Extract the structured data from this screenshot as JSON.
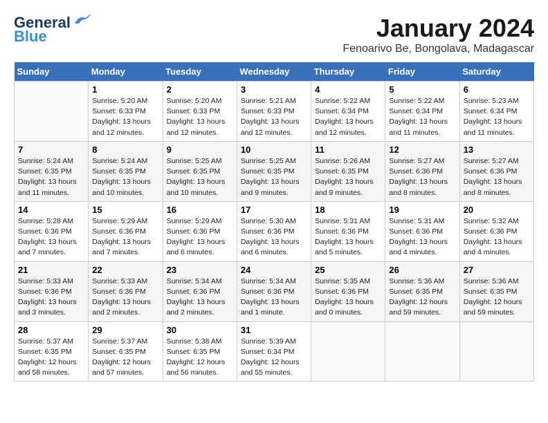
{
  "header": {
    "logo_line1": "General",
    "logo_line2": "Blue",
    "month_title": "January 2024",
    "location": "Fenoarivo Be, Bongolava, Madagascar"
  },
  "days_of_week": [
    "Sunday",
    "Monday",
    "Tuesday",
    "Wednesday",
    "Thursday",
    "Friday",
    "Saturday"
  ],
  "weeks": [
    [
      {
        "day": "",
        "sunrise": "",
        "sunset": "",
        "daylight": ""
      },
      {
        "day": "1",
        "sunrise": "Sunrise: 5:20 AM",
        "sunset": "Sunset: 6:33 PM",
        "daylight": "Daylight: 13 hours and 12 minutes."
      },
      {
        "day": "2",
        "sunrise": "Sunrise: 5:20 AM",
        "sunset": "Sunset: 6:33 PM",
        "daylight": "Daylight: 13 hours and 12 minutes."
      },
      {
        "day": "3",
        "sunrise": "Sunrise: 5:21 AM",
        "sunset": "Sunset: 6:33 PM",
        "daylight": "Daylight: 13 hours and 12 minutes."
      },
      {
        "day": "4",
        "sunrise": "Sunrise: 5:22 AM",
        "sunset": "Sunset: 6:34 PM",
        "daylight": "Daylight: 13 hours and 12 minutes."
      },
      {
        "day": "5",
        "sunrise": "Sunrise: 5:22 AM",
        "sunset": "Sunset: 6:34 PM",
        "daylight": "Daylight: 13 hours and 11 minutes."
      },
      {
        "day": "6",
        "sunrise": "Sunrise: 5:23 AM",
        "sunset": "Sunset: 6:34 PM",
        "daylight": "Daylight: 13 hours and 11 minutes."
      }
    ],
    [
      {
        "day": "7",
        "sunrise": "Sunrise: 5:24 AM",
        "sunset": "Sunset: 6:35 PM",
        "daylight": "Daylight: 13 hours and 11 minutes."
      },
      {
        "day": "8",
        "sunrise": "Sunrise: 5:24 AM",
        "sunset": "Sunset: 6:35 PM",
        "daylight": "Daylight: 13 hours and 10 minutes."
      },
      {
        "day": "9",
        "sunrise": "Sunrise: 5:25 AM",
        "sunset": "Sunset: 6:35 PM",
        "daylight": "Daylight: 13 hours and 10 minutes."
      },
      {
        "day": "10",
        "sunrise": "Sunrise: 5:25 AM",
        "sunset": "Sunset: 6:35 PM",
        "daylight": "Daylight: 13 hours and 9 minutes."
      },
      {
        "day": "11",
        "sunrise": "Sunrise: 5:26 AM",
        "sunset": "Sunset: 6:35 PM",
        "daylight": "Daylight: 13 hours and 9 minutes."
      },
      {
        "day": "12",
        "sunrise": "Sunrise: 5:27 AM",
        "sunset": "Sunset: 6:36 PM",
        "daylight": "Daylight: 13 hours and 8 minutes."
      },
      {
        "day": "13",
        "sunrise": "Sunrise: 5:27 AM",
        "sunset": "Sunset: 6:36 PM",
        "daylight": "Daylight: 13 hours and 8 minutes."
      }
    ],
    [
      {
        "day": "14",
        "sunrise": "Sunrise: 5:28 AM",
        "sunset": "Sunset: 6:36 PM",
        "daylight": "Daylight: 13 hours and 7 minutes."
      },
      {
        "day": "15",
        "sunrise": "Sunrise: 5:29 AM",
        "sunset": "Sunset: 6:36 PM",
        "daylight": "Daylight: 13 hours and 7 minutes."
      },
      {
        "day": "16",
        "sunrise": "Sunrise: 5:29 AM",
        "sunset": "Sunset: 6:36 PM",
        "daylight": "Daylight: 13 hours and 6 minutes."
      },
      {
        "day": "17",
        "sunrise": "Sunrise: 5:30 AM",
        "sunset": "Sunset: 6:36 PM",
        "daylight": "Daylight: 13 hours and 6 minutes."
      },
      {
        "day": "18",
        "sunrise": "Sunrise: 5:31 AM",
        "sunset": "Sunset: 6:36 PM",
        "daylight": "Daylight: 13 hours and 5 minutes."
      },
      {
        "day": "19",
        "sunrise": "Sunrise: 5:31 AM",
        "sunset": "Sunset: 6:36 PM",
        "daylight": "Daylight: 13 hours and 4 minutes."
      },
      {
        "day": "20",
        "sunrise": "Sunrise: 5:32 AM",
        "sunset": "Sunset: 6:36 PM",
        "daylight": "Daylight: 13 hours and 4 minutes."
      }
    ],
    [
      {
        "day": "21",
        "sunrise": "Sunrise: 5:33 AM",
        "sunset": "Sunset: 6:36 PM",
        "daylight": "Daylight: 13 hours and 3 minutes."
      },
      {
        "day": "22",
        "sunrise": "Sunrise: 5:33 AM",
        "sunset": "Sunset: 6:36 PM",
        "daylight": "Daylight: 13 hours and 2 minutes."
      },
      {
        "day": "23",
        "sunrise": "Sunrise: 5:34 AM",
        "sunset": "Sunset: 6:36 PM",
        "daylight": "Daylight: 13 hours and 2 minutes."
      },
      {
        "day": "24",
        "sunrise": "Sunrise: 5:34 AM",
        "sunset": "Sunset: 6:36 PM",
        "daylight": "Daylight: 13 hours and 1 minute."
      },
      {
        "day": "25",
        "sunrise": "Sunrise: 5:35 AM",
        "sunset": "Sunset: 6:36 PM",
        "daylight": "Daylight: 13 hours and 0 minutes."
      },
      {
        "day": "26",
        "sunrise": "Sunrise: 5:36 AM",
        "sunset": "Sunset: 6:35 PM",
        "daylight": "Daylight: 12 hours and 59 minutes."
      },
      {
        "day": "27",
        "sunrise": "Sunrise: 5:36 AM",
        "sunset": "Sunset: 6:35 PM",
        "daylight": "Daylight: 12 hours and 59 minutes."
      }
    ],
    [
      {
        "day": "28",
        "sunrise": "Sunrise: 5:37 AM",
        "sunset": "Sunset: 6:35 PM",
        "daylight": "Daylight: 12 hours and 58 minutes."
      },
      {
        "day": "29",
        "sunrise": "Sunrise: 5:37 AM",
        "sunset": "Sunset: 6:35 PM",
        "daylight": "Daylight: 12 hours and 57 minutes."
      },
      {
        "day": "30",
        "sunrise": "Sunrise: 5:38 AM",
        "sunset": "Sunset: 6:35 PM",
        "daylight": "Daylight: 12 hours and 56 minutes."
      },
      {
        "day": "31",
        "sunrise": "Sunrise: 5:39 AM",
        "sunset": "Sunset: 6:34 PM",
        "daylight": "Daylight: 12 hours and 55 minutes."
      },
      {
        "day": "",
        "sunrise": "",
        "sunset": "",
        "daylight": ""
      },
      {
        "day": "",
        "sunrise": "",
        "sunset": "",
        "daylight": ""
      },
      {
        "day": "",
        "sunrise": "",
        "sunset": "",
        "daylight": ""
      }
    ]
  ]
}
